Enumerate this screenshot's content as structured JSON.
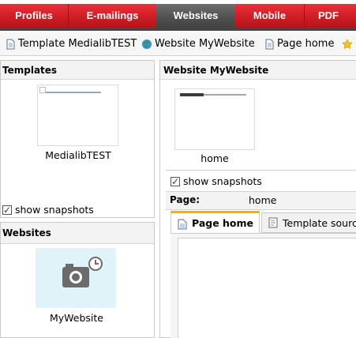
{
  "nav": {
    "items": [
      {
        "label": "Profiles",
        "active": false
      },
      {
        "label": "E-mailings",
        "active": false
      },
      {
        "label": "Websites",
        "active": true
      },
      {
        "label": "Mobile",
        "active": false
      },
      {
        "label": "PDF",
        "active": false
      }
    ]
  },
  "breadcrumbs": [
    {
      "icon": "page-icon",
      "label": "Template MedialibTEST"
    },
    {
      "icon": "globe-icon",
      "label": "Website MyWebsite"
    },
    {
      "icon": "page-icon",
      "label": "Page home"
    },
    {
      "icon": "star-icon",
      "label": ""
    }
  ],
  "templates": {
    "title": "Templates",
    "items": [
      {
        "name": "MedialibTEST"
      }
    ],
    "show_snapshots_label": "show snapshots",
    "show_snapshots_checked": true
  },
  "websites": {
    "title": "Websites",
    "items": [
      {
        "name": "MyWebsite"
      }
    ]
  },
  "website": {
    "title": "Website MyWebsite",
    "pages": [
      {
        "name": "home"
      }
    ],
    "show_snapshots_label": "show snapshots",
    "show_snapshots_checked": true,
    "page_label": "Page:",
    "page_value": "home",
    "tabs": [
      {
        "label": "Page home",
        "active": true,
        "icon": "page-icon"
      },
      {
        "label": "Template source",
        "active": false,
        "icon": "source-icon"
      }
    ]
  },
  "colors": {
    "nav_red": "#cf1d24",
    "nav_active": "#4f4f4f",
    "tab_accent": "#f0b400",
    "snapshot_bg": "#dff3f8"
  }
}
